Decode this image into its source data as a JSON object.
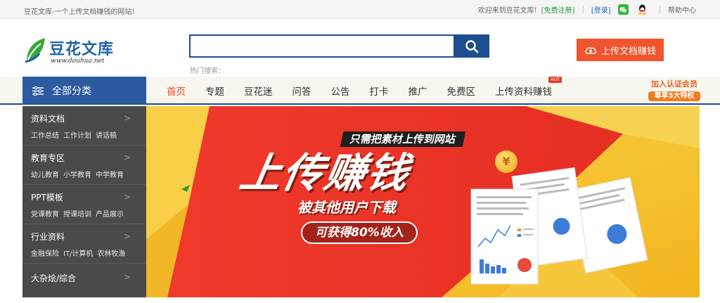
{
  "topbar": {
    "slogan": "豆花文库-一个上传文档赚钱的网站!",
    "welcome": "欢迎来到豆花文库!",
    "register": "[免费注册]",
    "login": "[登录]",
    "help": "帮助中心"
  },
  "header": {
    "logo_name": "豆花文库",
    "logo_url": "www.douhua.net",
    "search_placeholder": "",
    "hot_search_label": "热门搜索：",
    "upload_button": "上传文档赚钱"
  },
  "nav": {
    "all_categories": "全部分类",
    "items": [
      {
        "label": "首页"
      },
      {
        "label": "专题"
      },
      {
        "label": "豆花迷"
      },
      {
        "label": "问答"
      },
      {
        "label": "公告"
      },
      {
        "label": "打卡"
      },
      {
        "label": "推广"
      },
      {
        "label": "免费区"
      },
      {
        "label": "上传资料赚钱"
      }
    ],
    "hot_badge": "HOT",
    "member_line1": "加入认证会员",
    "member_line2": "尊享5大特权"
  },
  "sidebar": {
    "categories": [
      {
        "title": "资料文档",
        "subs": [
          "工作总结",
          "工作计划",
          "讲话稿"
        ]
      },
      {
        "title": "教育专区",
        "subs": [
          "幼儿教育",
          "小学教育",
          "中学教育"
        ]
      },
      {
        "title": "PPT模板",
        "subs": [
          "党课教育",
          "授课培训",
          "产品展示"
        ]
      },
      {
        "title": "行业资料",
        "subs": [
          "金融保险",
          "IT/计算机",
          "农林牧渔"
        ]
      },
      {
        "title": "大杂烩/综合",
        "subs": []
      }
    ]
  },
  "banner": {
    "line1": "只需把素材上传到网站",
    "line2": "上传赚钱",
    "line3": "被其他用户下载",
    "line4": "可获得80%收入",
    "coin_symbol": "¥"
  },
  "colors": {
    "brand_blue": "#1d4e8f",
    "accent_orange": "#f0542c",
    "active_nav": "#e8461c",
    "sidebar_bg": "#4a4a4a"
  }
}
